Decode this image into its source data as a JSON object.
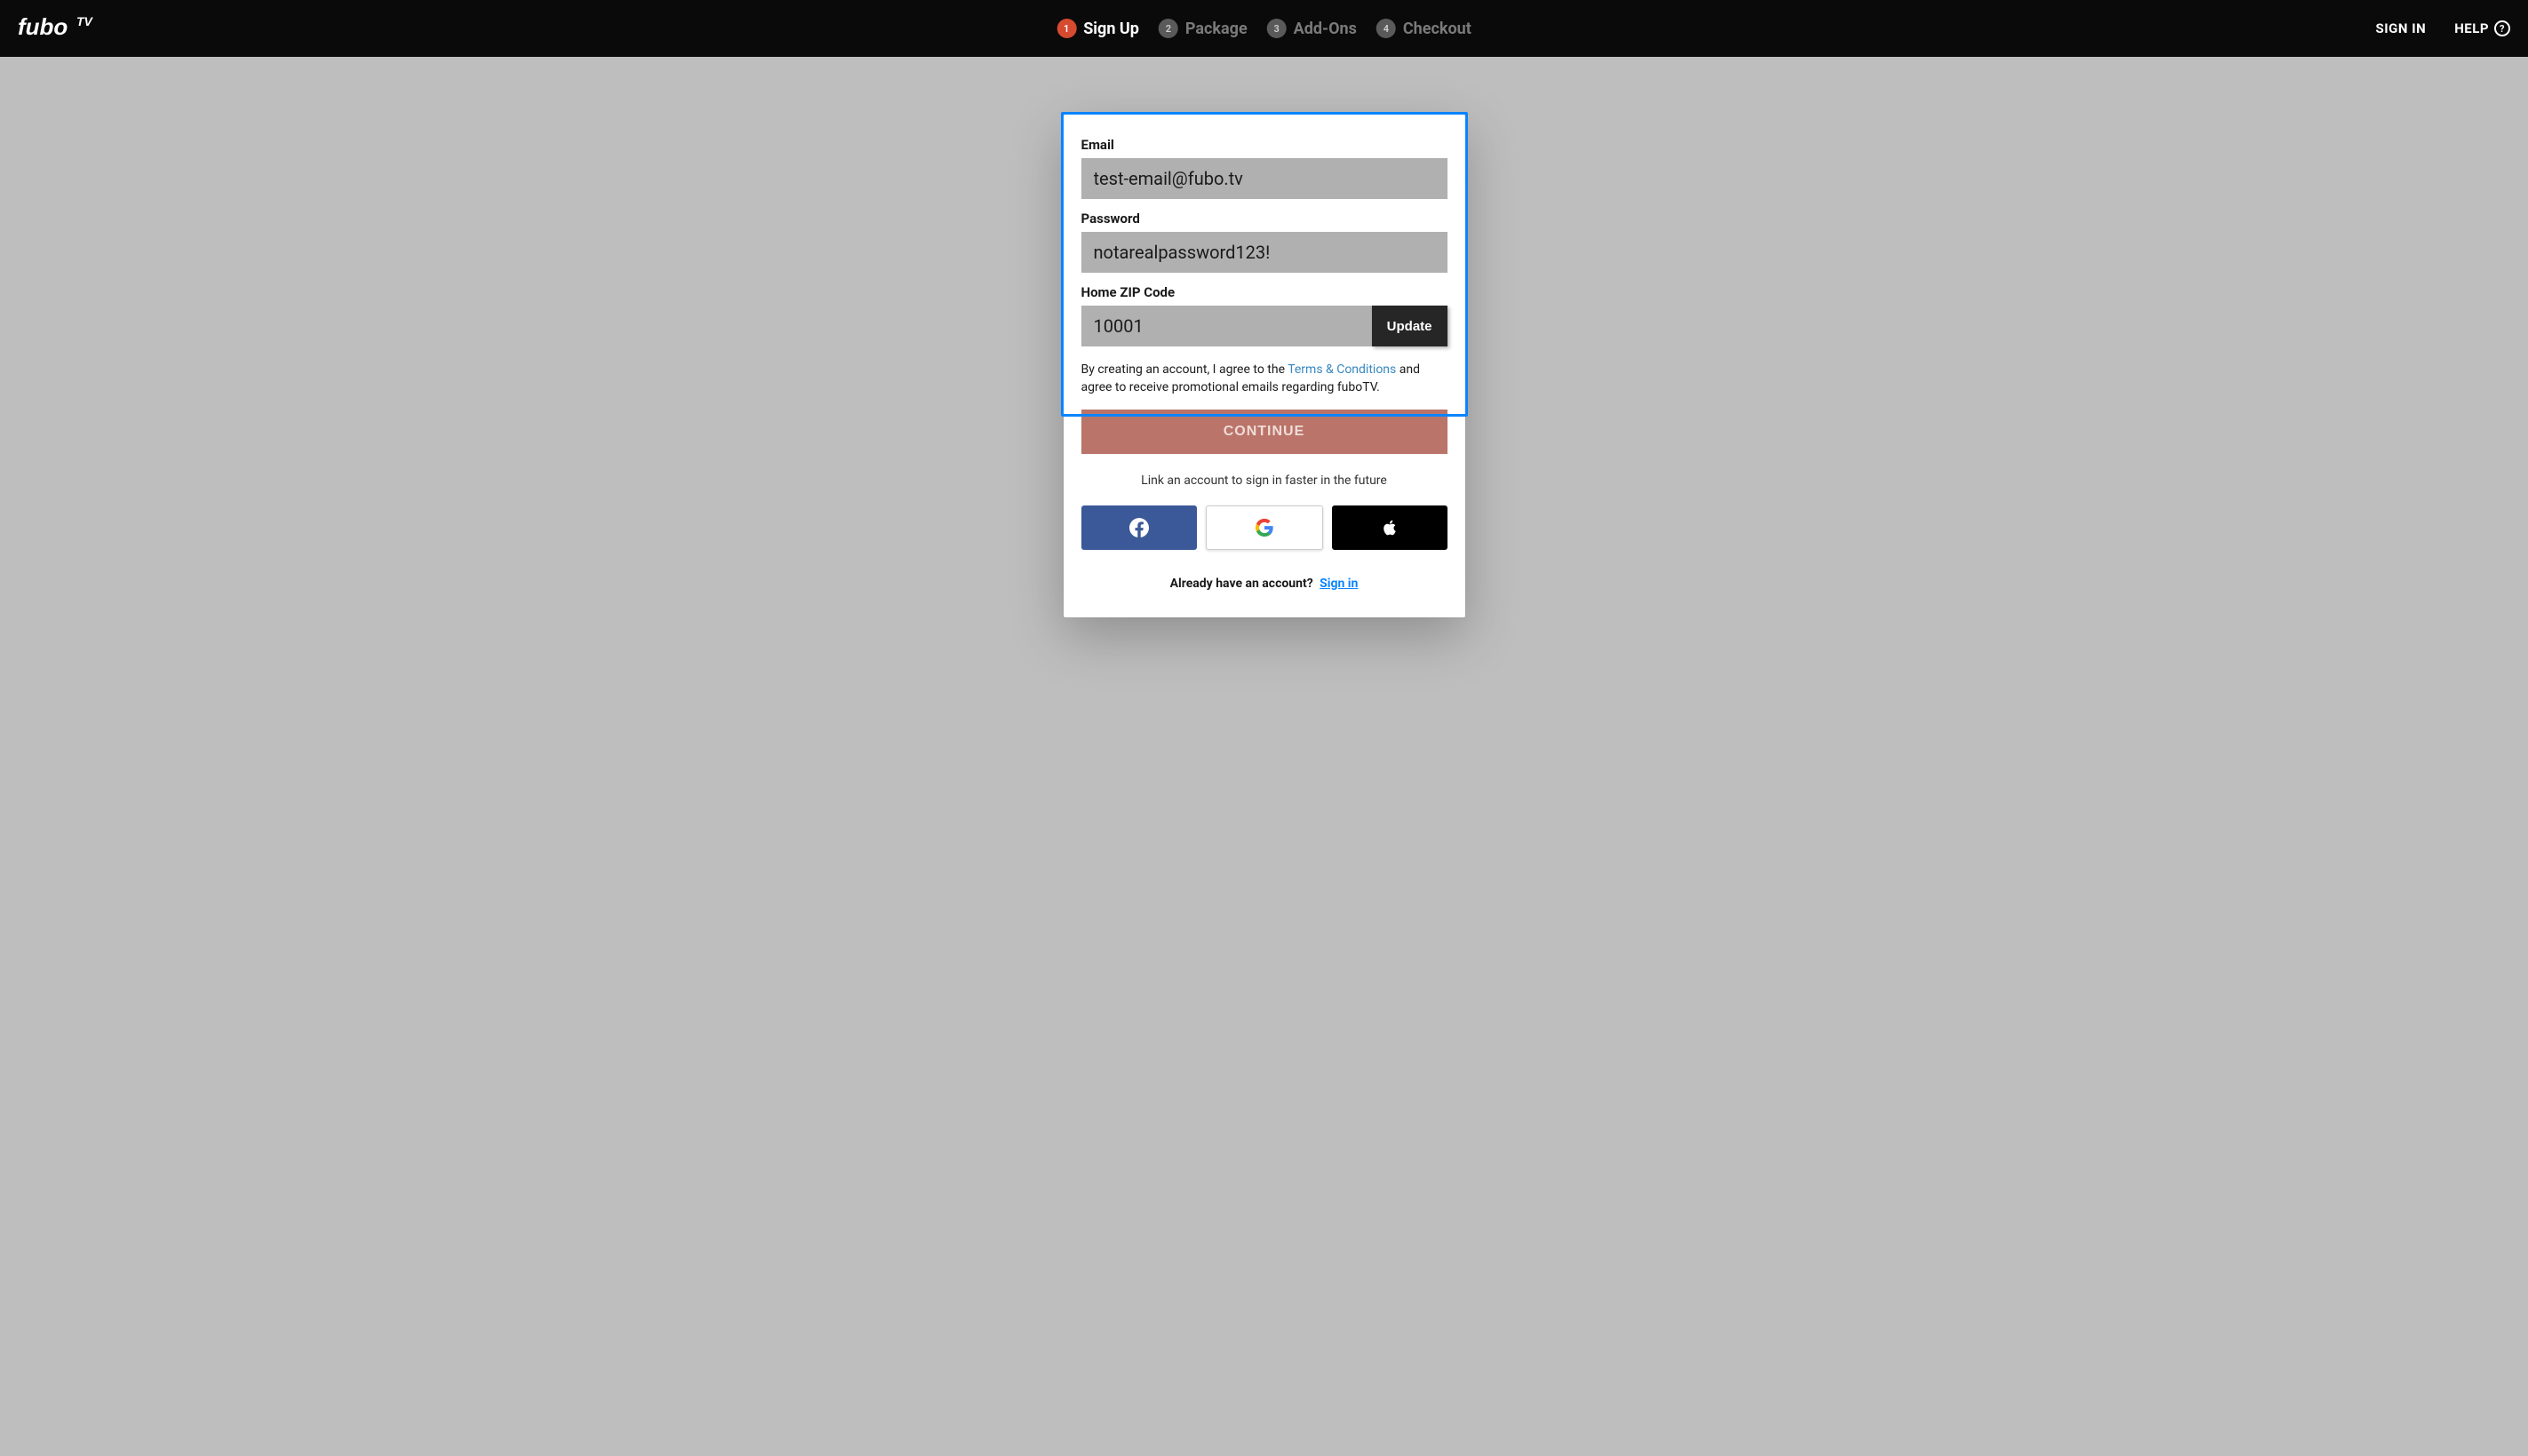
{
  "header": {
    "signin": "SIGN IN",
    "help": "HELP"
  },
  "steps": [
    {
      "num": "1",
      "label": "Sign Up",
      "active": true
    },
    {
      "num": "2",
      "label": "Package",
      "active": false
    },
    {
      "num": "3",
      "label": "Add-Ons",
      "active": false
    },
    {
      "num": "4",
      "label": "Checkout",
      "active": false
    }
  ],
  "form": {
    "email_label": "Email",
    "email_value": "test-email@fubo.tv",
    "password_label": "Password",
    "password_value": "notarealpassword123!",
    "zip_label": "Home ZIP Code",
    "zip_value": "10001",
    "update_btn": "Update",
    "terms_prefix": "By creating an account, I agree to the ",
    "terms_link": "Terms & Conditions",
    "terms_suffix": " and agree to receive promotional emails regarding fuboTV.",
    "continue_btn": "CONTINUE",
    "link_account_text": "Link an account to sign in faster in the future",
    "already_text": "Already have an account? ",
    "already_signin": "Sign in"
  }
}
